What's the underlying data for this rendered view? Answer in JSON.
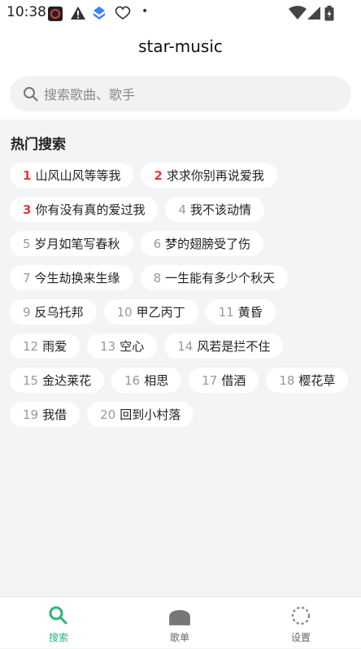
{
  "status_bar": {
    "time": "10:38"
  },
  "header": {
    "title": "star-music"
  },
  "search": {
    "placeholder": "搜索歌曲、歌手",
    "value": ""
  },
  "hot_search": {
    "title": "热门搜索",
    "items": [
      {
        "rank": "1",
        "text": "山风山风等等我"
      },
      {
        "rank": "2",
        "text": "求求你别再说爱我"
      },
      {
        "rank": "3",
        "text": "你有没有真的爱过我"
      },
      {
        "rank": "4",
        "text": "我不该动情"
      },
      {
        "rank": "5",
        "text": "岁月如笔写春秋"
      },
      {
        "rank": "6",
        "text": "梦的翅膀受了伤"
      },
      {
        "rank": "7",
        "text": "今生劫换来生缘"
      },
      {
        "rank": "8",
        "text": "一生能有多少个秋天"
      },
      {
        "rank": "9",
        "text": "反乌托邦"
      },
      {
        "rank": "10",
        "text": "甲乙丙丁"
      },
      {
        "rank": "11",
        "text": "黄昏"
      },
      {
        "rank": "12",
        "text": "雨爱"
      },
      {
        "rank": "13",
        "text": "空心"
      },
      {
        "rank": "14",
        "text": "风若是拦不住"
      },
      {
        "rank": "15",
        "text": "金达莱花"
      },
      {
        "rank": "16",
        "text": "相思"
      },
      {
        "rank": "17",
        "text": "借酒"
      },
      {
        "rank": "18",
        "text": "樱花草"
      },
      {
        "rank": "19",
        "text": "我借"
      },
      {
        "rank": "20",
        "text": "回到小村落"
      }
    ]
  },
  "tabs": [
    {
      "label": "搜索",
      "icon": "search-icon",
      "active": true
    },
    {
      "label": "歌单",
      "icon": "playlist-icon",
      "active": false
    },
    {
      "label": "设置",
      "icon": "settings-icon",
      "active": false
    }
  ],
  "colors": {
    "accent": "#2db37a",
    "hot_rank": "#e33b3b",
    "page_bg": "#f3f4f6"
  }
}
